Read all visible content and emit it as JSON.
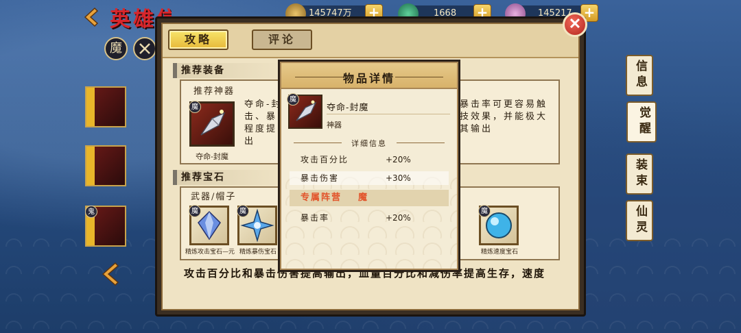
{
  "header": {
    "title": "英雄信息",
    "resources": [
      {
        "name": "coin",
        "value": "145747万",
        "icon": "coin-icon"
      },
      {
        "name": "jade",
        "value": "1668",
        "icon": "jade-icon"
      },
      {
        "name": "crystal",
        "value": "145217",
        "icon": "crystal-icon"
      }
    ]
  },
  "side": {
    "faction_label": "魔",
    "hero3_badge": "鬼"
  },
  "window": {
    "tabs": [
      {
        "label": "攻略",
        "active": true
      },
      {
        "label": "评论",
        "active": false
      }
    ],
    "close_label": "✕",
    "section_equip": "推荐装备",
    "artifact_title": "推荐神器",
    "artifact_name": "夺命-封魔",
    "artifact_badge": "魔",
    "artifact_desc_left": "夺命-封\n击、暴\n程度提\n出",
    "artifact_desc_right": "暴击率可更容易触\n技效果，并能极大\n其输出",
    "section_gem": "推荐宝石",
    "gem_sub_title": "武器/帽子",
    "gems": [
      {
        "badge": "魔",
        "caption": "精炼攻击宝石—元"
      },
      {
        "badge": "魔",
        "caption": "精炼暴伤宝石"
      }
    ],
    "gem_right": {
      "badge": "魔",
      "caption": "精炼速度宝石"
    },
    "gem_partial_caption": "石",
    "bottom_note": "攻击百分比和暴击伤害提高输出，血量百分比和减伤率提高生存，速度"
  },
  "right_tabs": [
    "信息",
    "觉醒",
    "装束",
    "仙灵"
  ],
  "popup": {
    "title": "物品详情",
    "item_name": "夺命-封魔",
    "item_type": "神器",
    "item_badge": "魔",
    "detail_title": "详细信息",
    "stats": [
      {
        "name": "攻击百分比",
        "value": "+20%",
        "highlight": false
      },
      {
        "name": "暴击伤害",
        "value": "+30%",
        "highlight": true
      }
    ],
    "camp_label": "专属阵营",
    "camp_value": "魔",
    "camp_stats": [
      {
        "name": "暴击率",
        "value": "+20%"
      }
    ]
  },
  "colors": {
    "accent_gold": "#e6b93a",
    "title_red": "#d8262b",
    "camp_orange": "#e2532a",
    "close_red": "#b2231c"
  }
}
